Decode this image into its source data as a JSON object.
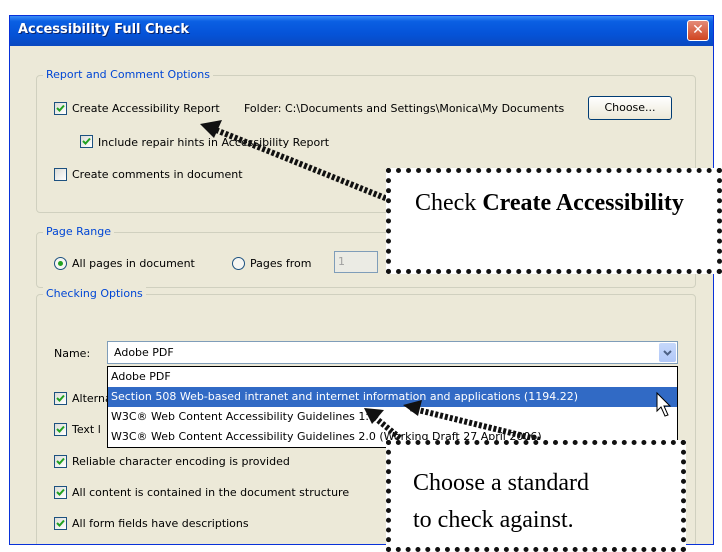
{
  "window": {
    "title": "Accessibility Full Check",
    "close": "✕"
  },
  "report": {
    "group_label": "Report and Comment Options",
    "create_report_label": "Create Accessibility Report",
    "folder_text": "Folder: C:\\Documents and Settings\\Monica\\My Documents",
    "choose_label": "Choose...",
    "repair_hints_label": "Include repair hints in Accessibility Report",
    "comments_label": "Create comments in document"
  },
  "page_range": {
    "group_label": "Page Range",
    "all_pages_label": "All pages in document",
    "pages_from_label": "Pages from",
    "from_value": "1"
  },
  "checking": {
    "group_label": "Checking Options",
    "name_label": "Name:",
    "selected": "Adobe PDF",
    "options": [
      "Adobe PDF",
      "Section 508 Web-based intranet and internet information and applications (1194.22)",
      "W3C® Web Content Accessibility Guidelines 1.0",
      "W3C® Web Content Accessibility Guidelines 2.0 (Working Draft 27 April 2006)"
    ],
    "highlighted_index": 1,
    "check_items": [
      "Alternate",
      "Text l",
      "Reliable character encoding is provided",
      "All content is contained in the document structure",
      "All form fields have descriptions"
    ]
  },
  "callouts": {
    "one": {
      "pre": "Check ",
      "bold": "Create Accessibility"
    },
    "two": {
      "line1": "Choose a standard",
      "line2": "to check against."
    }
  }
}
